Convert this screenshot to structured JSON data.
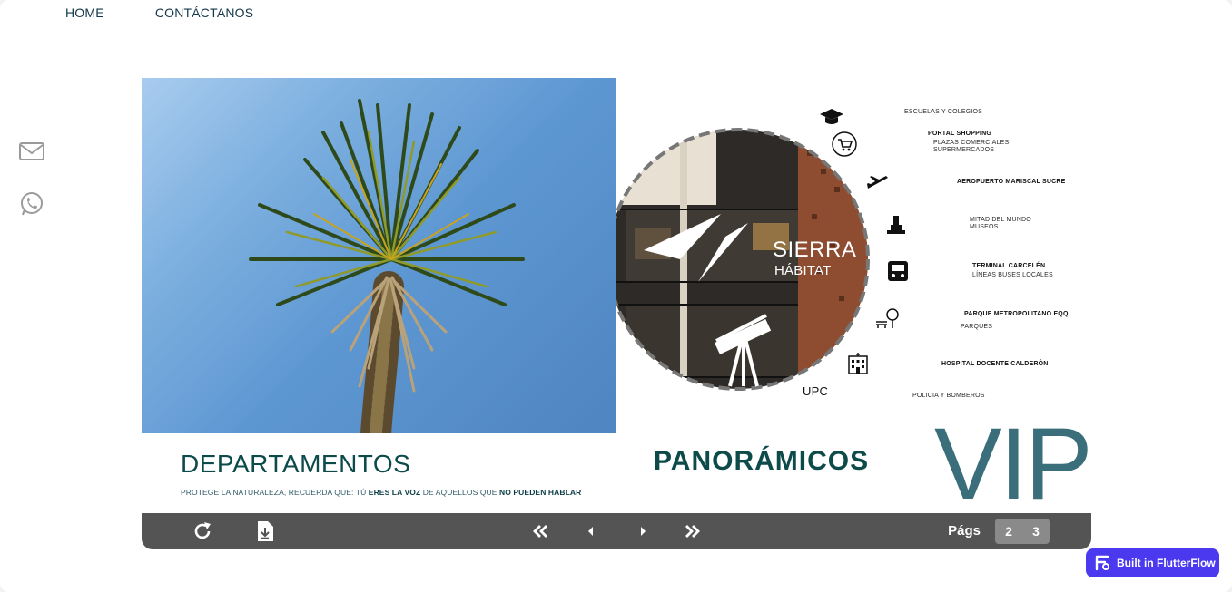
{
  "nav": {
    "home": "HOME",
    "contact": "CONTÁCTANOS"
  },
  "side": {
    "mail_icon": "mail-icon",
    "whatsapp_icon": "whatsapp-icon"
  },
  "left_page": {
    "title": "DEPARTAMENTOS",
    "tagline_pre": "PROTEGE LA NATURALEZA, RECUERDA QUE: TÚ ",
    "tagline_b1": "ERES LA VOZ",
    "tagline_mid": " DE AQUELLOS QUE ",
    "tagline_b2": "NO PUEDEN HABLAR"
  },
  "right_page": {
    "title": "PANORÁMICOS",
    "vip": "VIP",
    "brand_name": "SIERRA",
    "brand_sub": "HÁBITAT",
    "upc": "UPC",
    "poi": {
      "schools": "ESCUELAS Y COLEGIOS",
      "portal": "PORTAL SHOPPING",
      "plazas": "PLAZAS COMERCIALES",
      "supermarkets": "SUPERMERCADOS",
      "airport": "AEROPUERTO MARISCAL SUCRE",
      "mitad": "MITAD DEL MUNDO",
      "museos": "MUSEOS",
      "terminal": "TERMINAL CARCELÉN",
      "buses": "LÍNEAS BUSES LOCALES",
      "parque": "PARQUE METROPOLITANO EQQ",
      "parques": "PARQUES",
      "hospital": "HOSPITAL DOCENTE CALDERÒN",
      "policia": "POLICIA Y BOMBEROS"
    }
  },
  "toolbar": {
    "pages_label": "Págs",
    "page_a": "2",
    "page_b": "3"
  },
  "badge": {
    "label": "Built in FlutterFlow"
  }
}
